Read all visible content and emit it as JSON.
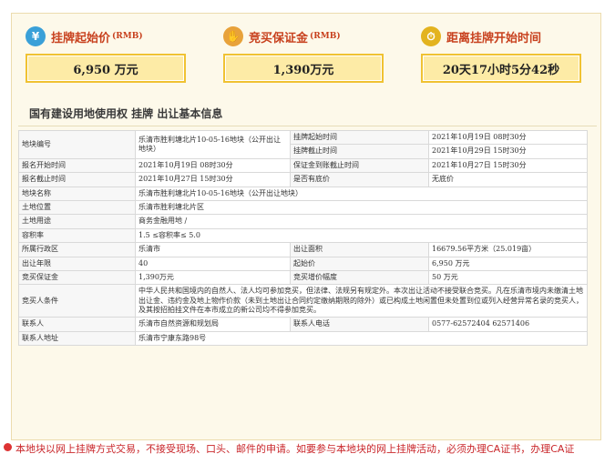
{
  "stats": [
    {
      "label": "挂牌起始价",
      "unit": "(RMB)",
      "value": "6,950  万元",
      "icon": "money-icon"
    },
    {
      "label": "竞买保证金",
      "unit": "(RMB)",
      "value": "1,390万元",
      "icon": "hand-coin-icon"
    },
    {
      "label": "距离挂牌开始时间",
      "unit": "",
      "value": "20天17小时5分42秒",
      "icon": "stopwatch-icon"
    }
  ],
  "section_title": "国有建设用地使用权 挂牌 出让基本信息",
  "table": {
    "r1": {
      "k1": "地块编号",
      "v1": "乐清市胜利塘北片10-05-16地块（公开出让地块）",
      "k2a": "挂牌起始时间",
      "v2a": "2021年10月19日 08时30分",
      "k2b": "挂牌截止时间",
      "v2b": "2021年10月29日 15时30分"
    },
    "r2": {
      "k1": "报名开始时间",
      "v1": "2021年10月19日 08时30分",
      "k2": "保证金到账截止时间",
      "v2": "2021年10月27日 15时30分"
    },
    "r3": {
      "k1": "报名截止时间",
      "v1": "2021年10月27日 15时30分",
      "k2": "是否有底价",
      "v2": "无底价"
    },
    "r4": {
      "k": "地块名称",
      "v": "乐清市胜利塘北片10-05-16地块（公开出让地块）"
    },
    "r5": {
      "k": "土地位置",
      "v": "乐清市胜利塘北片区"
    },
    "r6": {
      "k": "土地用途",
      "v": "商务金融用地 /"
    },
    "r7": {
      "k": "容积率",
      "v": "1.5 ≤容积率≤ 5.0"
    },
    "r8": {
      "k1": "所属行政区",
      "v1": "乐清市",
      "k2": "出让面积",
      "v2": "16679.56平方米（25.019亩）"
    },
    "r9": {
      "k1": "出让年限",
      "v1": "40",
      "k2": "起始价",
      "v2": "6,950 万元"
    },
    "r10": {
      "k1": "竞买保证金",
      "v1": "1,390万元",
      "k2": "竞买增价幅度",
      "v2": "50 万元"
    },
    "r11": {
      "k": "竞买人条件",
      "v": "中华人民共和国境内的自然人、法人均可参加竞买，但法律、法规另有规定外。本次出让活动不接受联合竞买。凡在乐清市境内未缴清土地出让金、违约金及地上物作价款（未到土地出让合同约定缴纳期限的除外）或已构成土地闲置但未处置到位或列入经营异常名录的竞买人，及其按招拍挂文件在本市成立的新公司均不得参加竞买。"
    },
    "r12": {
      "k1": "联系人",
      "v1": "乐清市自然资源和规划局",
      "k2": "联系人电话",
      "v2": "0577-62572404 62571406"
    },
    "r13": {
      "k": "联系人地址",
      "v": "乐清市宁康东路98号"
    }
  },
  "footer_text": "本地块以网上挂牌方式交易，不接受现场、口头、邮件的申请。如要参与本地块的网上挂牌活动，必须办理CA证书，办理CA证",
  "colors": {
    "accent": "#c8411e",
    "box_border": "#f0c232",
    "box_fill": "#fdeba6",
    "frame_bg": "#fdf9ea"
  }
}
